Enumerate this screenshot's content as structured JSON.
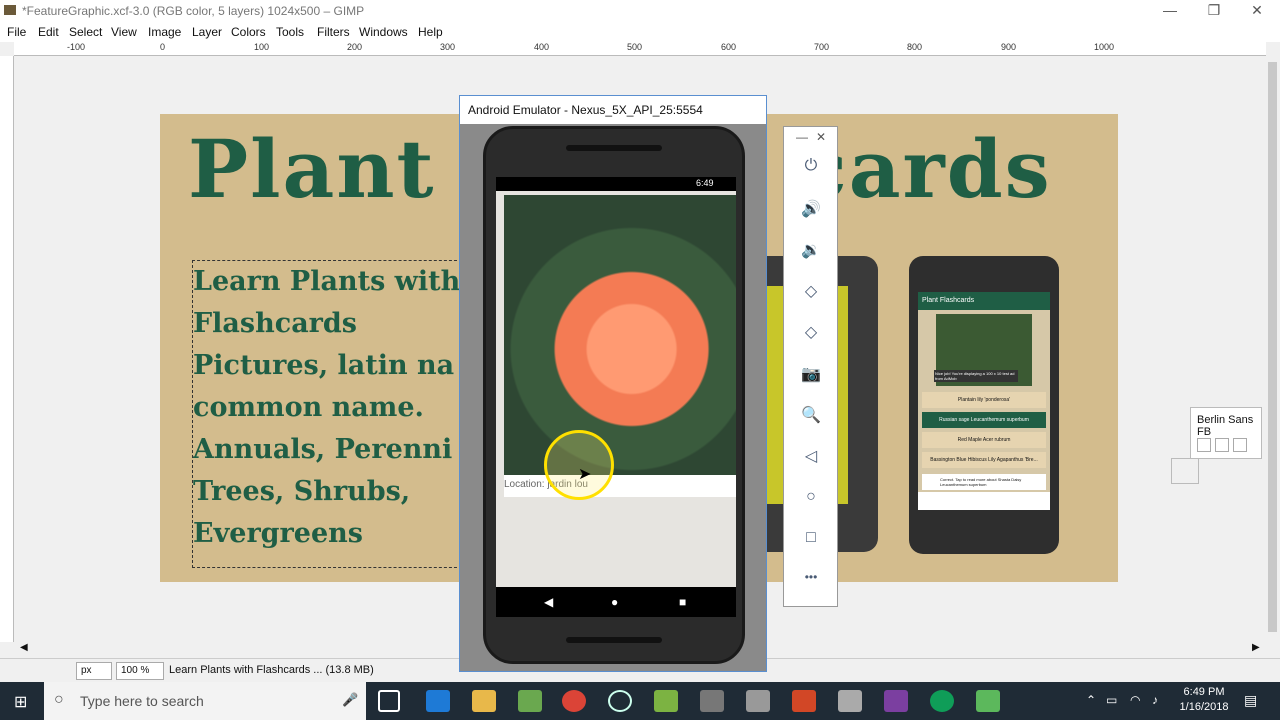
{
  "window": {
    "title": "*FeatureGraphic.xcf-3.0 (RGB color, 5 layers) 1024x500 – GIMP"
  },
  "menu": [
    "File",
    "Edit",
    "Select",
    "View",
    "Image",
    "Layer",
    "Colors",
    "Tools",
    "Filters",
    "Windows",
    "Help"
  ],
  "ruler": [
    "-100",
    "0",
    "100",
    "200",
    "300",
    "400",
    "500",
    "600",
    "700",
    "800",
    "900",
    "1000"
  ],
  "canvas": {
    "title_left": "Plant",
    "title_right": "cards",
    "text_lines": [
      "Learn Plants with",
      "Flashcards",
      "Pictures, latin na",
      "common name.",
      "Annuals, Perenni",
      "Trees, Shrubs,",
      "Evergreens"
    ]
  },
  "mini_phone": {
    "app_title": "Plant Flashcards",
    "toast": "Nice job! You're displaying a 100 x 10 test ad from AdMob",
    "answers": [
      "Plantain lily 'ponderosa'",
      "Russian sage Leucanthemum superbum",
      "Red Maple Acer rubrum",
      "Bassington Blue Hibiscus Lily Agapanthus 'Bre..."
    ],
    "footer": "Correct. Tap to read more about Shasta Daisy Leucanthemum superbum"
  },
  "emulator": {
    "title": "Android Emulator - Nexus_5X_API_25:5554",
    "time": "6:49",
    "location": "Location: jardin lou",
    "nav": [
      "◀",
      "●",
      "■"
    ]
  },
  "emulator_tools": [
    "⏻",
    "🔊",
    "🔉",
    "◇",
    "◇",
    "📷",
    "🔍",
    "◁",
    "○",
    "□",
    "•••"
  ],
  "font_panel": {
    "font_name": "Berlin Sans FB"
  },
  "status": {
    "unit": "px",
    "zoom": "100 %",
    "info": "Learn Plants with Flashcards ... (13.8 MB)"
  },
  "taskbar": {
    "search_placeholder": "Type here to search",
    "time": "6:49 PM",
    "date": "1/16/2018"
  }
}
